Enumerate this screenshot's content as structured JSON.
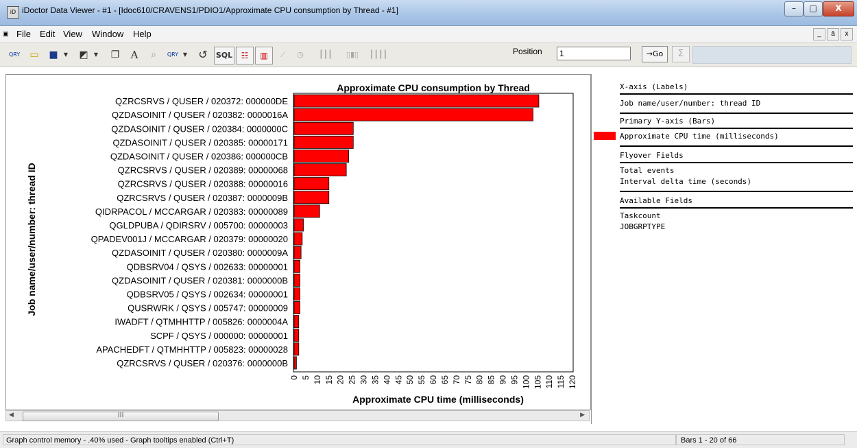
{
  "window": {
    "title": "iDoctor Data Viewer - #1 - [Idoc610/CRAVENS1/PDIO1/Approximate CPU consumption by Thread - #1]",
    "minimize": "–",
    "maximize": "□",
    "close": "X"
  },
  "menu": {
    "items": [
      "File",
      "Edit",
      "View",
      "Window",
      "Help"
    ],
    "mdi": [
      "_",
      "ā",
      "x"
    ]
  },
  "toolbar": {
    "sql_label": "SQL",
    "text_label": "A",
    "position_label": "Position",
    "position_value": "1",
    "go_label": "→Go",
    "sum_label": "Σ",
    "qry_label": "QRY"
  },
  "chart_data": {
    "type": "bar",
    "orientation": "horizontal",
    "title": "Approximate CPU consumption by Thread",
    "xlabel": "Approximate CPU time (milliseconds)",
    "ylabel": "Job name/user/number: thread ID",
    "xlim": [
      0,
      120
    ],
    "x_ticks": [
      "0",
      "5",
      "10",
      "15",
      "20",
      "25",
      "30",
      "35",
      "40",
      "45",
      "50",
      "55",
      "60",
      "65",
      "70",
      "75",
      "80",
      "85",
      "90",
      "95",
      "100",
      "105",
      "110",
      "115",
      "120"
    ],
    "grid": false,
    "bar_color": "#ff0000",
    "categories": [
      "QZRCSRVS / QUSER / 020372: 000000DE",
      "QZDASOINIT / QUSER / 020382: 0000016A",
      "QZDASOINIT / QUSER / 020384: 0000000C",
      "QZDASOINIT / QUSER / 020385: 00000171",
      "QZDASOINIT / QUSER / 020386: 000000CB",
      "QZRCSRVS / QUSER / 020389: 00000068",
      "QZRCSRVS / QUSER / 020388: 00000016",
      "QZRCSRVS / QUSER / 020387: 0000009B",
      "QIDRPACOL / MCCARGAR / 020383: 00000089",
      "QGLDPUBA / QDIRSRV / 005700: 00000003",
      "QPADEV001J / MCCARGAR / 020379: 00000020",
      "QZDASOINIT / QUSER / 020380: 0000009A",
      "QDBSRV04 / QSYS / 002633: 00000001",
      "QZDASOINIT / QUSER / 020381: 0000000B",
      "QDBSRV05 / QSYS / 002634: 00000001",
      "QUSRWRK / QSYS / 005747: 00000009",
      "IWADFT / QTMHHTTP / 005826: 0000004A",
      "SCPF / QSYS / 000000: 00000001",
      "APACHEDFT / QTMHHTTP / 005823: 00000028",
      "QZRCSRVS / QUSER / 020376: 0000000B"
    ],
    "values": [
      105.5,
      103,
      25.5,
      25.5,
      23.5,
      22.5,
      15,
      15,
      11,
      4,
      3.5,
      3,
      2.5,
      2.5,
      2.5,
      2.5,
      2,
      2,
      2,
      1
    ]
  },
  "fields_panel": {
    "xaxis_header": "X-axis (Labels)",
    "xaxis_field": "Job name/user/number: thread ID",
    "yaxis_header": "Primary Y-axis (Bars)",
    "yaxis_field": "Approximate CPU time (milliseconds)",
    "flyover_header": "Flyover Fields",
    "flyover_fields": [
      "Total events",
      "Interval delta time (seconds)"
    ],
    "available_header": "Available Fields",
    "available_fields": [
      "Taskcount",
      "JOBGRPTYPE"
    ]
  },
  "statusbar": {
    "left": "Graph control memory - .40% used - Graph tooltips enabled (Ctrl+T)",
    "right": "Bars 1 - 20 of 66"
  },
  "scrollbar": {
    "thumb_grip": "III"
  }
}
